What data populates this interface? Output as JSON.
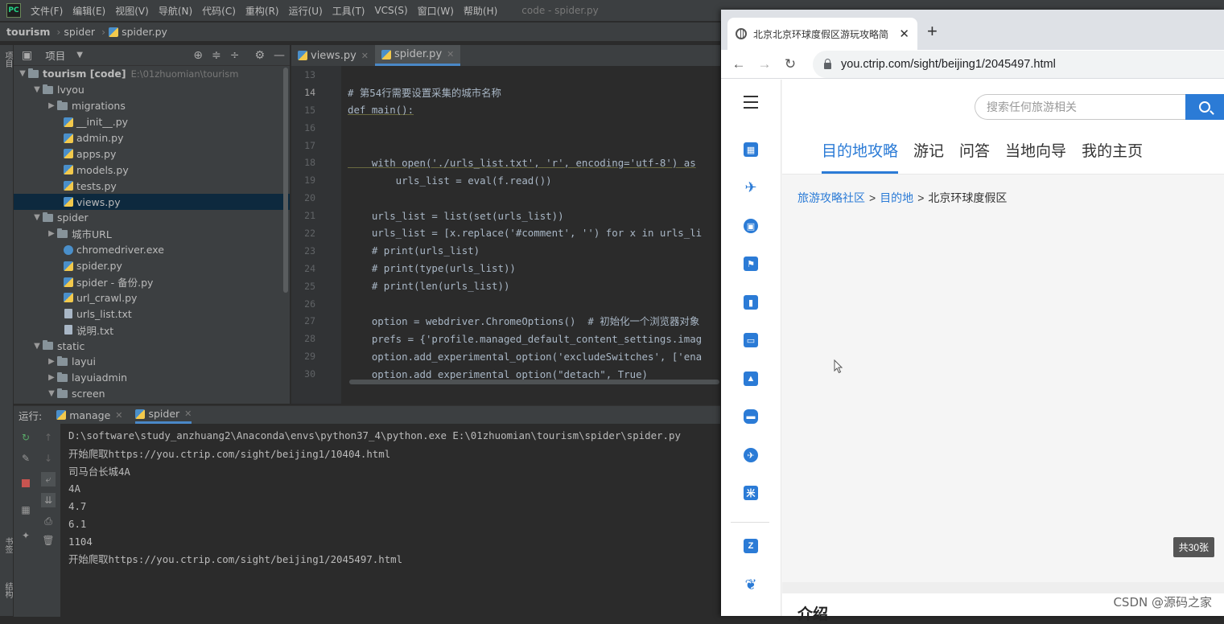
{
  "ide": {
    "menu": [
      "文件(F)",
      "编辑(E)",
      "视图(V)",
      "导航(N)",
      "代码(C)",
      "重构(R)",
      "运行(U)",
      "工具(T)",
      "VCS(S)",
      "窗口(W)",
      "帮助(H)"
    ],
    "window_title": "code - spider.py",
    "breadcrumb": [
      "tourism",
      "spider",
      "spider.py"
    ],
    "left_strip_labels": [
      "项目",
      "书签",
      "结构"
    ],
    "project_panel": {
      "title": "项目",
      "root_name": "tourism [code]",
      "root_path": "E:\\01zhuomian\\tourism",
      "items": [
        {
          "name": "lvyou"
        },
        {
          "name": "migrations"
        },
        {
          "name": "__init__.py"
        },
        {
          "name": "admin.py"
        },
        {
          "name": "apps.py"
        },
        {
          "name": "models.py"
        },
        {
          "name": "tests.py"
        },
        {
          "name": "views.py"
        },
        {
          "name": "spider"
        },
        {
          "name": "城市URL"
        },
        {
          "name": "chromedriver.exe"
        },
        {
          "name": "spider.py"
        },
        {
          "name": "spider - 备份.py"
        },
        {
          "name": "url_crawl.py"
        },
        {
          "name": "urls_list.txt"
        },
        {
          "name": "说明.txt"
        },
        {
          "name": "static"
        },
        {
          "name": "layui"
        },
        {
          "name": "layuiadmin"
        },
        {
          "name": "screen"
        }
      ]
    },
    "editor_tabs": [
      "views.py",
      "spider.py"
    ],
    "code_lines": [
      {
        "n": "13",
        "t": ""
      },
      {
        "n": "14",
        "t": "# 第54行需要设置采集的城市名称"
      },
      {
        "n": "15",
        "t": "def main():"
      },
      {
        "n": "16",
        "t": ""
      },
      {
        "n": "17",
        "t": ""
      },
      {
        "n": "18",
        "t": "    with open('./urls_list.txt', 'r', encoding='utf-8') as"
      },
      {
        "n": "19",
        "t": "        urls_list = eval(f.read())"
      },
      {
        "n": "20",
        "t": ""
      },
      {
        "n": "21",
        "t": "    urls_list = list(set(urls_list))"
      },
      {
        "n": "22",
        "t": "    urls_list = [x.replace('#comment', '') for x in urls_li"
      },
      {
        "n": "23",
        "t": "    # print(urls_list)"
      },
      {
        "n": "24",
        "t": "    # print(type(urls_list))"
      },
      {
        "n": "25",
        "t": "    # print(len(urls_list))"
      },
      {
        "n": "26",
        "t": ""
      },
      {
        "n": "27",
        "t": "    option = webdriver.ChromeOptions()  # 初始化一个浏览器对象"
      },
      {
        "n": "28",
        "t": "    prefs = {'profile.managed_default_content_settings.imag"
      },
      {
        "n": "29",
        "t": "    option.add_experimental_option('excludeSwitches', ['ena"
      },
      {
        "n": "30",
        "t": "    option.add_experimental_option(\"detach\", True)"
      }
    ],
    "run": {
      "label": "运行:",
      "tabs": [
        "manage",
        "spider"
      ],
      "console": [
        "D:\\software\\study_anzhuang2\\Anaconda\\envs\\python37_4\\python.exe E:\\01zhuomian\\tourism\\spider\\spider.py",
        "开始爬取https://you.ctrip.com/sight/beijing1/10404.html",
        "司马台长城4A",
        "4A",
        "4.7",
        "6.1",
        "1104",
        "开始爬取https://you.ctrip.com/sight/beijing1/2045497.html"
      ]
    }
  },
  "browser": {
    "tab_title": "北京北京环球度假区游玩攻略简",
    "url": "you.ctrip.com/sight/beijing1/2045497.html",
    "search_placeholder": "搜索任何旅游相关",
    "nav_tabs": [
      "目的地攻略",
      "游记",
      "问答",
      "当地向导",
      "我的主页"
    ],
    "breadcrumb": {
      "a": "旅游攻略社区",
      "b": "目的地",
      "current": "北京环球度假区"
    },
    "photo_count": "共30张",
    "section_title": "介绍",
    "accent": "#2b7bd6"
  },
  "watermark": "CSDN @源码之家"
}
